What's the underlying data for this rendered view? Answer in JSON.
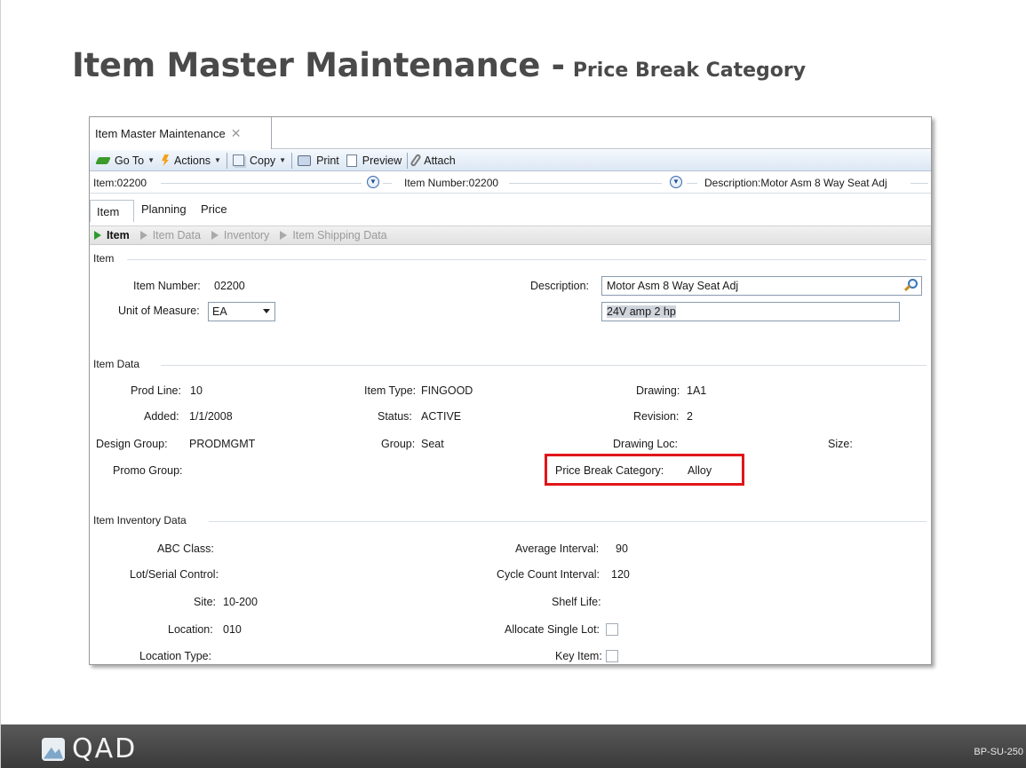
{
  "slide": {
    "title_main": "Item Master Maintenance -",
    "title_sub": "Price Break Category",
    "footer_brand": "QAD",
    "slide_code": "BP-SU-250"
  },
  "window": {
    "tab_title": "Item Master Maintenance",
    "tab_close": "✕",
    "toolbar": {
      "goto": "Go To",
      "actions": "Actions",
      "copy": "Copy",
      "print": "Print",
      "preview": "Preview",
      "attach": "Attach"
    },
    "keys": {
      "item": "Item:02200",
      "item_number": "Item Number:02200",
      "description": "Description:Motor Asm 8 Way Seat Adj"
    },
    "tabs": [
      "Item",
      "Planning",
      "Price"
    ],
    "steps": [
      "Item",
      "Item Data",
      "Inventory",
      "Item Shipping Data"
    ],
    "item": {
      "section": "Item",
      "item_number_label": "Item Number:",
      "item_number_value": "02200",
      "uom_label": "Unit of Measure:",
      "uom_value": "EA",
      "description_label": "Description:",
      "description_value": "Motor Asm 8 Way Seat Adj",
      "description2_value": "24V amp 2 hp"
    },
    "item_data": {
      "section": "Item Data",
      "prod_line_label": "Prod Line:",
      "prod_line_value": "10",
      "added_label": "Added:",
      "added_value": "1/1/2008",
      "design_group_label": "Design Group:",
      "design_group_value": "PRODMGMT",
      "promo_group_label": "Promo Group:",
      "item_type_label": "Item Type:",
      "item_type_value": "FINGOOD",
      "status_label": "Status:",
      "status_value": "ACTIVE",
      "group_label": "Group:",
      "group_value": "Seat",
      "drawing_label": "Drawing:",
      "drawing_value": "1A1",
      "revision_label": "Revision:",
      "revision_value": "2",
      "drawing_loc_label": "Drawing Loc:",
      "size_label": "Size:",
      "price_break_label": "Price Break Category:",
      "price_break_value": "Alloy"
    },
    "inventory": {
      "section": "Item Inventory Data",
      "abc_label": "ABC Class:",
      "lot_serial_label": "Lot/Serial Control:",
      "site_label": "Site:",
      "site_value": "10-200",
      "location_label": "Location:",
      "location_value": "010",
      "location_type_label": "Location Type:",
      "avg_interval_label": "Average Interval:",
      "avg_interval_value": "90",
      "cycle_count_label": "Cycle Count Interval:",
      "cycle_count_value": "120",
      "shelf_life_label": "Shelf Life:",
      "allocate_label": "Allocate Single Lot:",
      "key_item_label": "Key Item:"
    }
  }
}
